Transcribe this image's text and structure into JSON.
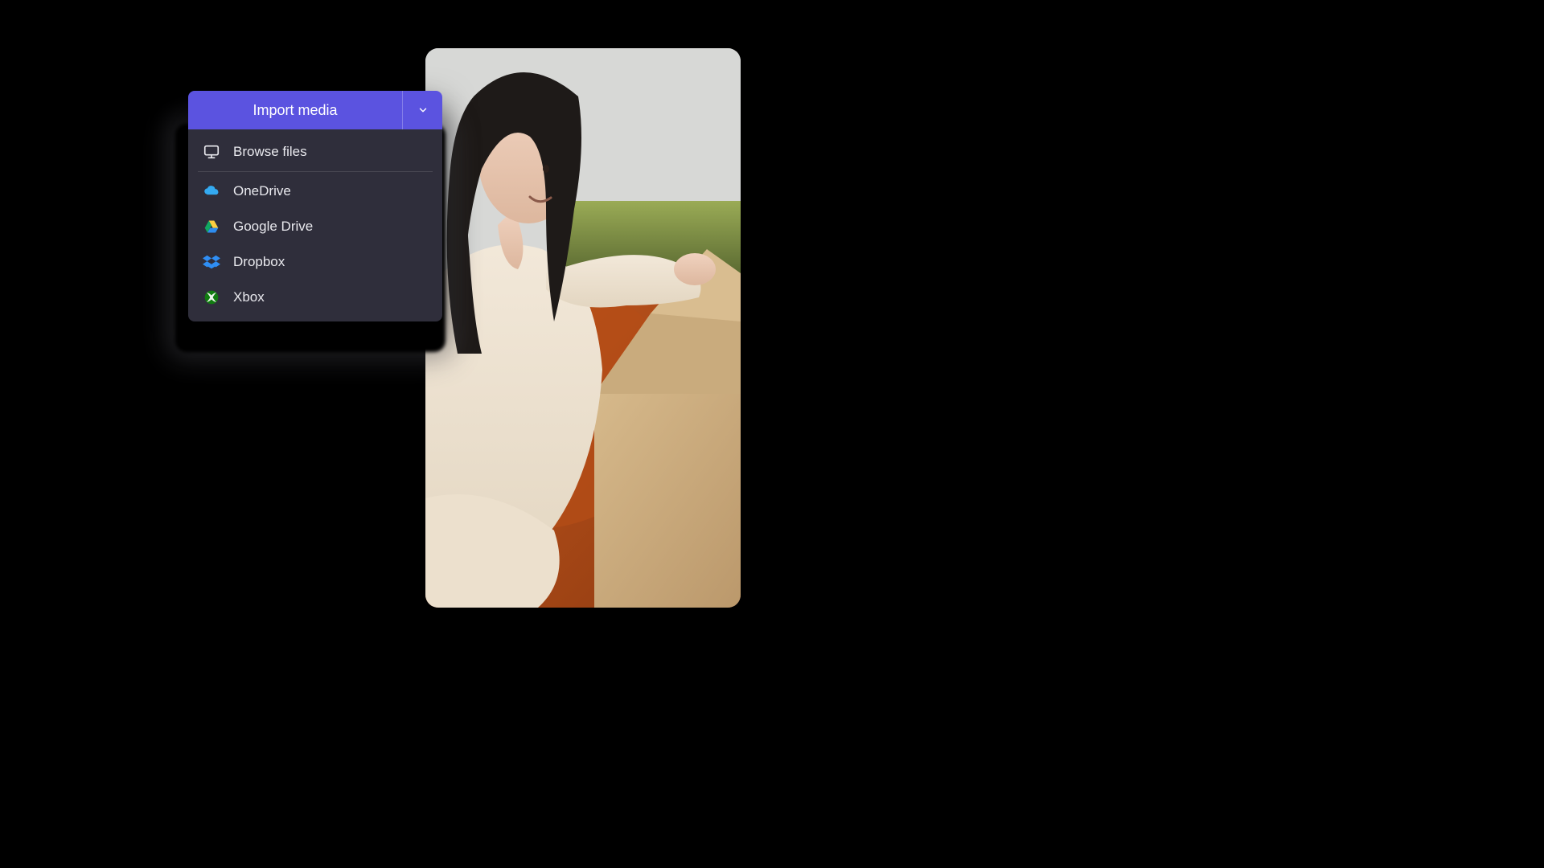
{
  "import": {
    "button_label": "Import media",
    "items": [
      {
        "icon": "monitor-icon",
        "label": "Browse files"
      },
      {
        "icon": "onedrive-icon",
        "label": "OneDrive"
      },
      {
        "icon": "gdrive-icon",
        "label": "Google Drive"
      },
      {
        "icon": "dropbox-icon",
        "label": "Dropbox"
      },
      {
        "icon": "xbox-icon",
        "label": "Xbox"
      }
    ]
  },
  "colors": {
    "accent": "#5b53e0",
    "panel": "#2f2e3b"
  },
  "preview": {
    "description": "person-opening-cardboard-box"
  }
}
